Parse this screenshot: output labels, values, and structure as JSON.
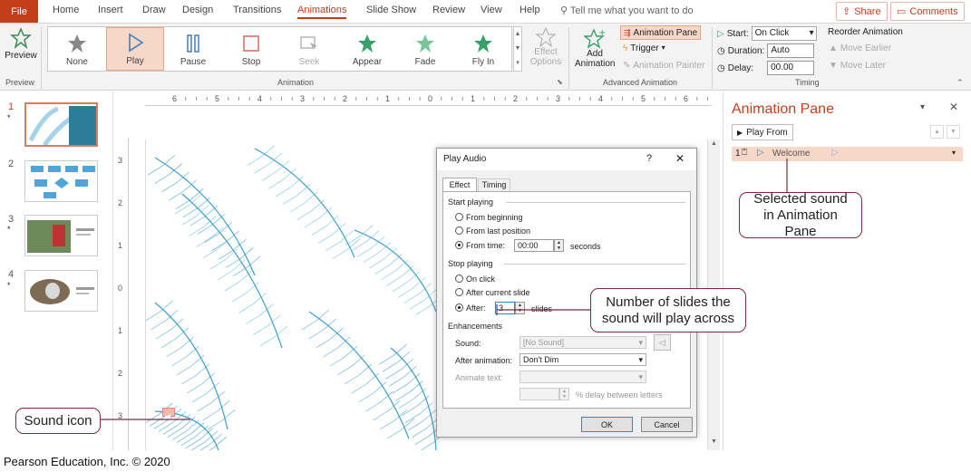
{
  "tabs": {
    "file": "File",
    "items": [
      "Home",
      "Insert",
      "Draw",
      "Design",
      "Transitions",
      "Animations",
      "Slide Show",
      "Review",
      "View",
      "Help"
    ],
    "tell_me": "Tell me what you want to do",
    "share": "Share",
    "comments": "Comments"
  },
  "ribbon": {
    "preview_label": "Preview",
    "preview_group": "Preview",
    "gallery": [
      "None",
      "Play",
      "Pause",
      "Stop",
      "Seek",
      "Appear",
      "Fade",
      "Fly In"
    ],
    "effect_options": "Effect Options",
    "animation_group": "Animation",
    "add_animation": "Add Animation",
    "animation_pane": "Animation Pane",
    "trigger": "Trigger",
    "animation_painter": "Animation Painter",
    "advanced_group": "Advanced Animation",
    "start_label": "Start:",
    "start_value": "On Click",
    "duration_label": "Duration:",
    "duration_value": "Auto",
    "delay_label": "Delay:",
    "delay_value": "00.00",
    "reorder": "Reorder Animation",
    "move_earlier": "Move Earlier",
    "move_later": "Move Later",
    "timing_group": "Timing"
  },
  "thumbnails": [
    "1",
    "2",
    "3",
    "4"
  ],
  "ruler_marks": [
    "6",
    "5",
    "4",
    "3",
    "2",
    "1",
    "0",
    "1",
    "2",
    "3",
    "4",
    "5",
    "6"
  ],
  "vruler_marks": [
    "3",
    "2",
    "1",
    "0",
    "1",
    "2",
    "3"
  ],
  "dialog": {
    "title": "Play Audio",
    "help": "?",
    "close": "✕",
    "tab_effect": "Effect",
    "tab_timing": "Timing",
    "start_playing": "Start playing",
    "from_beginning": "From beginning",
    "from_last": "From last position",
    "from_time": "From time:",
    "from_time_value": "00:00",
    "seconds": "seconds",
    "stop_playing": "Stop playing",
    "on_click": "On click",
    "after_current": "After current slide",
    "after": "After:",
    "after_value": "3",
    "slides": "slides",
    "enhancements": "Enhancements",
    "sound": "Sound:",
    "sound_value": "[No Sound]",
    "after_animation": "After animation:",
    "after_animation_value": "Don't Dim",
    "animate_text": "Animate text:",
    "delay_letters": "% delay between letters",
    "ok": "OK",
    "cancel": "Cancel"
  },
  "animation_pane": {
    "title": "Animation Pane",
    "play_from": "Play From",
    "item_num": "1",
    "item_label": "Welcome"
  },
  "callouts": {
    "selected_sound": "Selected sound in Animation Pane",
    "num_slides": "Number of slides the sound will play across",
    "sound_icon": "Sound icon"
  },
  "footer": "Pearson Education, Inc. © 2020",
  "colors": {
    "accent": "#c43e1c",
    "selected": "#f7d7c8",
    "feather": "#3a9fcf"
  }
}
